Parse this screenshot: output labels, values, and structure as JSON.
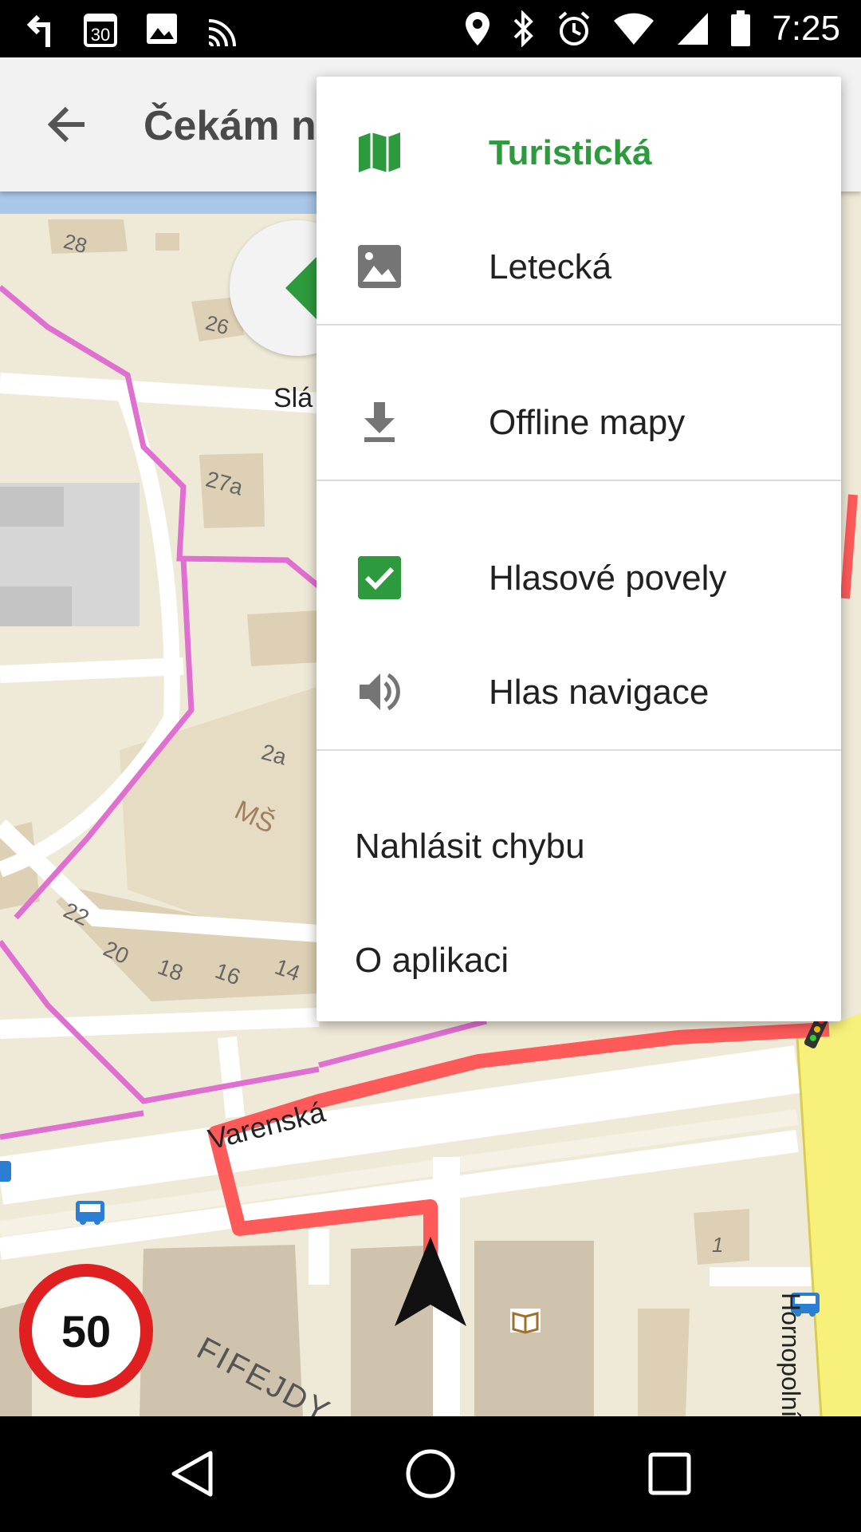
{
  "status_bar": {
    "time": "7:25",
    "icons_left": [
      "turn-left-icon",
      "calendar-30-icon",
      "image-icon",
      "cast-icon"
    ],
    "icons_right": [
      "location-icon",
      "bluetooth-icon",
      "alarm-icon",
      "wifi-icon",
      "signal-icon",
      "battery-icon"
    ]
  },
  "toolbar": {
    "title": "Čekám na"
  },
  "menu": {
    "items": [
      {
        "label": "Turistická",
        "icon": "map-icon",
        "active": true
      },
      {
        "label": "Letecká",
        "icon": "photo-icon"
      },
      {
        "label": "Offline mapy",
        "icon": "download-icon"
      },
      {
        "label": "Hlasové povely",
        "icon": "checkbox-checked-icon",
        "checked": true
      },
      {
        "label": "Hlas navigace",
        "icon": "volume-icon"
      },
      {
        "label": "Nahlásit chybu"
      },
      {
        "label": "O aplikaci"
      }
    ],
    "accent_color": "#2e9a3e"
  },
  "map": {
    "labels": {
      "street_varenska": "Varenská",
      "street_hornopolni": "Hornopolní",
      "district_fifejdy": "FIFEJDY",
      "street_partial": "Slá",
      "school": "MŠ",
      "n28": "28",
      "n26": "26",
      "n27a": "27a",
      "n2a": "2a",
      "n22": "22",
      "n20": "20",
      "n18": "18",
      "n16": "16",
      "n14": "14",
      "n1": "1"
    },
    "route_color": "#ff5a5a",
    "trail_color": "#e070d0"
  },
  "speed_limit": "50"
}
